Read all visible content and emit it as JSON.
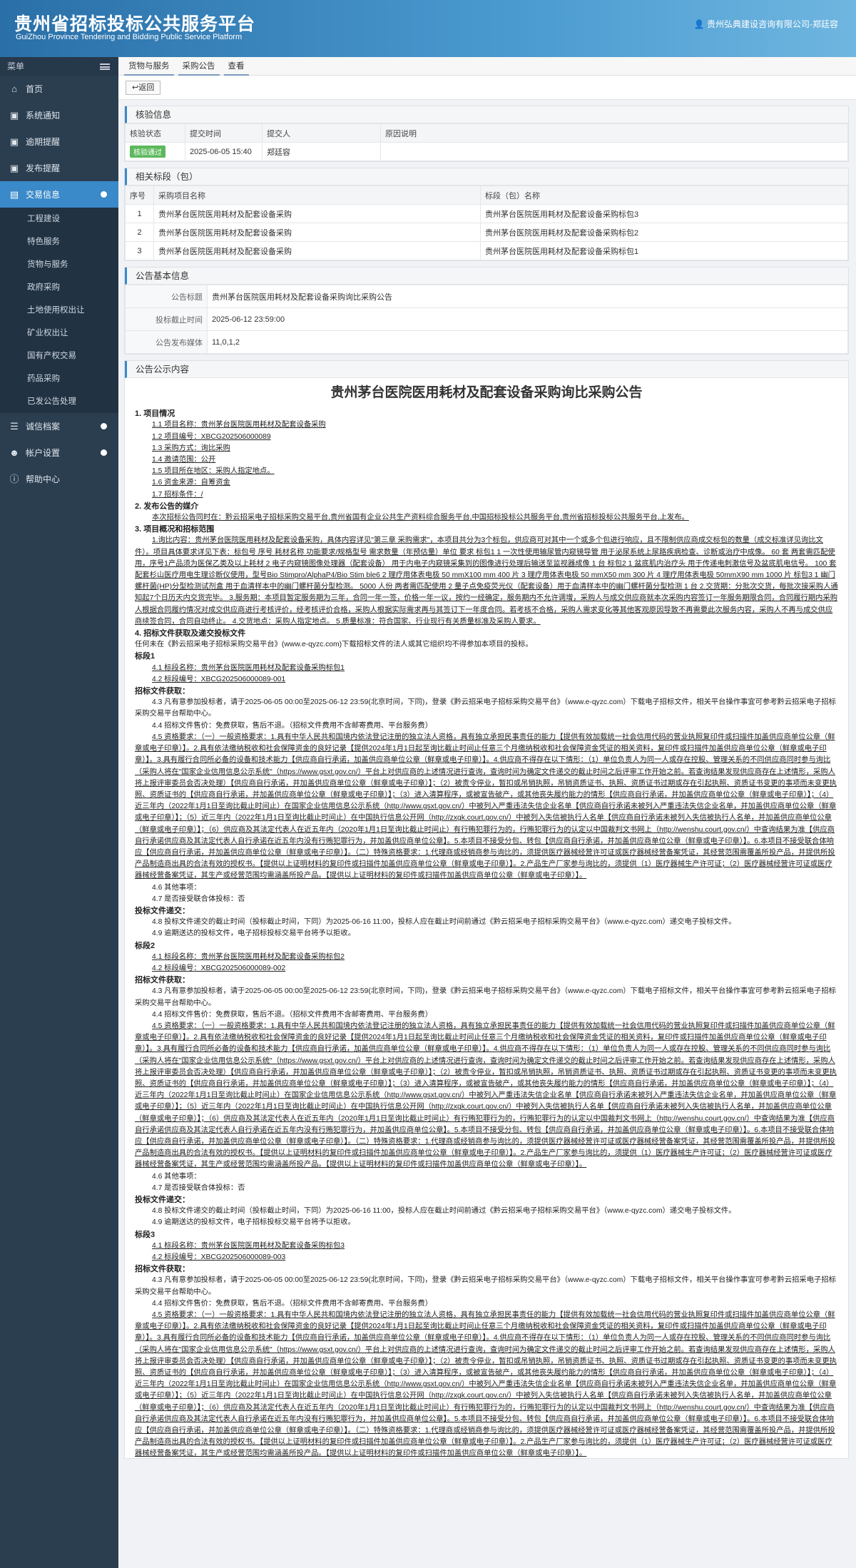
{
  "header": {
    "title": "贵州省招标投标公共服务平台",
    "subtitle": "GuiZhou Province Tendering and Bidding Public Service Platform",
    "user": "贵州弘典建设咨询有限公司-郑廷容"
  },
  "sidebar": {
    "menu_label": "菜单",
    "items": [
      {
        "label": "首页",
        "icon": "home-icon"
      },
      {
        "label": "系统通知",
        "icon": "monitor-icon"
      },
      {
        "label": "逾期提醒",
        "icon": "monitor-icon"
      },
      {
        "label": "发布提醒",
        "icon": "monitor-icon"
      },
      {
        "label": "交易信息",
        "icon": "folder-icon"
      }
    ],
    "sub_items": [
      "工程建设",
      "特色服务",
      "货物与服务",
      "政府采购",
      "土地使用权出让",
      "矿业权出让",
      "国有产权交易",
      "药品采购",
      "已发公告处理"
    ],
    "bottom_items": [
      {
        "label": "诚信档案",
        "icon": "list-icon"
      },
      {
        "label": "帐户设置",
        "icon": "user-icon"
      },
      {
        "label": "帮助中心",
        "icon": "help-icon"
      }
    ]
  },
  "breadcrumb": [
    "货物与服务",
    "采购公告",
    "查看"
  ],
  "toolbar": {
    "back_label": "返回"
  },
  "review": {
    "title": "核验信息",
    "headers": [
      "核验状态",
      "提交时间",
      "提交人",
      "原因说明"
    ],
    "status": "核验通过",
    "time": "2025-06-05 15:40",
    "submitter": "郑廷容",
    "reason": ""
  },
  "lots": {
    "title": "相关标段（包）",
    "headers": [
      "序号",
      "采购项目名称",
      "标段（包）名称"
    ],
    "rows": [
      {
        "no": "1",
        "project": "贵州茅台医院医用耗材及配套设备采购",
        "lot": "贵州茅台医院医用耗材及配套设备采购标包3"
      },
      {
        "no": "2",
        "project": "贵州茅台医院医用耗材及配套设备采购",
        "lot": "贵州茅台医院医用耗材及配套设备采购标包2"
      },
      {
        "no": "3",
        "project": "贵州茅台医院医用耗材及配套设备采购",
        "lot": "贵州茅台医院医用耗材及配套设备采购标包1"
      }
    ]
  },
  "basic": {
    "title": "公告基本信息",
    "rows": [
      {
        "label": "公告标题",
        "value": "贵州茅台医院医用耗材及配套设备采购询比采购公告"
      },
      {
        "label": "投标截止时间",
        "value": "2025-06-12 23:59:00"
      },
      {
        "label": "公告发布媒体",
        "value": "11,0,1,2"
      }
    ]
  },
  "content": {
    "title": "公告公示内容",
    "doc_title": "贵州茅台医院医用耗材及配套设备采购询比采购公告",
    "s1": "1. 项目情况",
    "s1_items": [
      "1.1 项目名称：贵州茅台医院医用耗材及配套设备采购",
      "1.2 项目编号：XBCG202506000089",
      "1.3 采购方式：询比采购",
      "1.4 邀请范围：公开",
      "1.5 项目所在地区：采购人指定地点。",
      "1.6 资金来源：自筹资金",
      "1.7 招标条件：/"
    ],
    "s2": "2. 发布公告的媒介",
    "s2_text": "本次招标公告同时在：黔云招采电子招标采购交易平台,贵州省国有企业公共生产资料综合服务平台,中国招标投标公共服务平台,贵州省招标投标公共服务平台,上发布。",
    "s3": "3. 项目概况和招标范围",
    "s3_text": "1.询比内容：贵州茅台医院医用耗材及配套设备采购，具体内容详见\"第三章 采购需求\"，本项目共分为3个标包，供应商可对其中一个或多个包进行响应，且不限制供应商成交标包的数量（成交标准详见询比文件）。项目具体要求详见下表：标包号 序号 耗材名称 功能要求/规格型号 需求数量（年预估量）单位 要求 标包1 1 一次性使用输尿管内窥镜导管 用于泌尿系统上尿路疾病检查、诊断或治疗中成像。 60 套 两套需匹配使用，序号1产品须为医保乙类及以上耗材 2 电子内窥镜图像处理器（配套设备） 用于内电子内窥镜采集到的图像进行处理后输送至监视器成像 1 台 标包2 1 盆底肌内治疗头 用于传递电刺激信号及盆底肌电信号。 100 套 配套杉山医疗用电生理诊断仪使用，型号Bio Stimpro/AlphaP4/Bio Stim ble6 2 理疗用体表电极 50 mmX100 mm 400 片 3 理疗用体表电极 50 mmX50 mm 300 片 4 理疗用体表电极 50mmX90 mm 1000 片 标包3 1 幽门螺杆菌(HP)分型检测试剂盒 用于血清样本中的幽门螺杆菌分型检测。 5000 人份 两者需匹配使用 2 量子点免疫荧光仪（配套设备）用于血清样本中的幽门螺杆菌分型检测 1 台 2.交货期：分批次交货，每批次接采购人通知起7个日历天内交货完毕。 3.服务期：本项目暂定服务期为三年，合同一年一签，价格一年一议，按约一经确定，服务期内不允许调增，采购人与成交供应商就本次采购内容签订一年服务期限合同，合同履行期内采购人根据合同履约情况对成交供应商进行考核评价，经考核评价合格，采购人根据实际需求再与其签订下一年度合同。若考核不合格，采购人需求变化等其他客观原因导致不再需要此次服务内容，采购人不再与成交供应商续签合同，合同自动终止。 4.交货地点：采购人指定地点。 5.质量标准：符合国家、行业现行有关质量标准及采购人要求。",
    "s4": "4. 招标文件获取及递交投标文件",
    "s4_text": "任何未在《黔云招采电子招标采购交易平台》(www.e-qyzc.com)下载招标文件的法人或其它组织均不得参加本项目的投标。",
    "lot1": "标段1",
    "lot1_name": "4.1 标段名称：贵州茅台医院医用耗材及配套设备采购标包1",
    "lot1_code": "4.2 标段编号：XBCG202506000089-001",
    "lot2": "标段2",
    "lot2_name": "4.1 标段名称：贵州茅台医院医用耗材及配套设备采购标包2",
    "lot2_code": "4.2 标段编号：XBCG202506000089-002",
    "lot3": "标段3",
    "lot3_name": "4.1 标段名称：贵州茅台医院医用耗材及配套设备采购标包3",
    "lot3_code": "4.2 标段编号：XBCG202506000089-003",
    "get_title": "招标文件获取：",
    "get_text": "4.3 凡有意参加投标者，请于2025-06-05 00:00至2025-06-12 23:59(北京时间，下同)，登录《黔云招采电子招标采购交易平台》（www.e-qyzc.com）下载电子招标文件，相关平台操作事宜可参考黔云招采电子招标采购交易平台帮助中心。",
    "price_text": "4.4 招标文件售价：免费获取，售后不退。（招标文件费用不含邮寄费用、平台服务费）",
    "qual_text": "4.5 资格要求：（一）一般资格要求：1.具有中华人民共和国境内依法登记注册的独立法人资格，具有独立承担民事责任的能力【提供有效加载统一社会信用代码的营业执照复印件或扫描件加盖供应商单位公章（鲜章或电子印章）】。2.具有依法缴纳税收和社会保障资金的良好记录【提供2024年1月1日起至询比截止时间止任意三个月缴纳税收和社会保障资金凭证的相关资料，复印件或扫描件加盖供应商单位公章（鲜章或电子印章）】。3.具有履行合同所必备的设备和技术能力【供应商自行承诺，加盖供应商单位公章（鲜章或电子印章）】。4.供应商不得存在以下情形：（1）单位负责人为同一人或存在控股、管理关系的不同供应商同时参与询比（采购人将在\"国家企业信用信息公示系统\"（https://www.gsxt.gov.cn/）平台上对供应商的上述情况进行查询，查询时间为确定文件递交的截止时间之后评审工作开始之前。若查询结果发现供应商存在上述情形，采购人将上报评审委员会否决处理）【供应商自行承诺，并加盖供应商单位公章（鲜章或电子印章）】；（2）被责令停业，暂扣或吊销执照，吊销资质证书、执照、资质证书过期或存在引起执照、资质证书变更的事项而未变更执照、资质证书的【供应商自行承诺，并加盖供应商单位公章（鲜章或电子印章）】；（3）进入清算程序，或被宣告破产，或其他丧失履约能力的情形【供应商自行承诺，并加盖供应商单位公章（鲜章或电子印章）】；（4）近三年内（2022年1月1日至询比截止时间止）在国家企业信用信息公示系统（http://www.gsxt.gov.cn/）中被列入严重违法失信企业名单【供应商自行承诺未被列入严重违法失信企业名单，并加盖供应商单位公章（鲜章或电子印章）】；（5）近三年内（2022年1月1日至询比截止时间止）在中国执行信息公开网（http://zxgk.court.gov.cn/）中被列入失信被执行人名单【供应商自行承诺未被列入失信被执行人名单，并加盖供应商单位公章（鲜章或电子印章）】；（6）供应商及其法定代表人在近五年内（2020年1月1日至询比截止时间止）有行贿犯罪行为的，行贿犯罪行为的认定以中国裁判文书网上（http://wenshu.court.gov.cn/）中查询结果为准【供应商自行承诺供应商及其法定代表人自行承诺在近五年内没有行贿犯罪行为，并加盖供应商单位公章】。5.本项目不接受分包、转包【供应商自行承诺，并加盖供应商单位公章（鲜章或电子印章）】。6.本项目不接受联合体响应【供应商自行承诺，并加盖供应商单位公章（鲜章或电子印章）】。（二）特殊资格要求：1.代理商或经销商参与询比的，须提供医疗器械经营许可证或医疗器械经营备案凭证，其经营范围需覆盖所投产品，并提供所投产品制造商出具的合法有效的授权书。【提供以上证明材料的复印件或扫描件加盖供应商单位公章（鲜章或电子印章）】。2.产品生产厂家参与询比的，须提供（1）医疗器械生产许可证；（2）医疗器械经营许可证或医疗器械经营备案凭证，其生产或经营范围均需涵盖所投产品。【提供以上证明材料的复印件或扫描件加盖供应商单位公章（鲜章或电子印章）】。",
    "other_text": "4.6 其他事项：",
    "consortium_text": "4.7 是否接受联合体投标：否",
    "submit_title": "投标文件递交：",
    "deadline_text": "4.8 投标文件递交的截止时间（投标截止时间，下同）为2025-06-16 11:00，投标人应在截止时间前通过《黔云招采电子招标采购交易平台》（www.e-qyzc.com）递交电子投标文件。",
    "late_text": "4.9 逾期送达的投标文件，电子招标投标交易平台将予以拒收。"
  }
}
